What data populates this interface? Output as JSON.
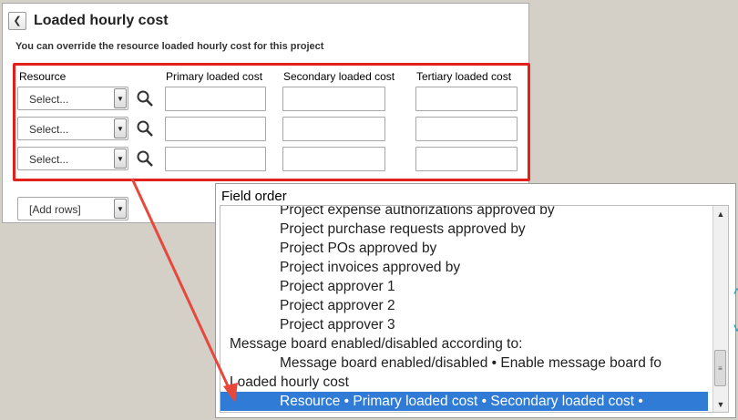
{
  "panel": {
    "collapse_icon": "double-chevron-up-icon",
    "title": "Loaded hourly cost",
    "subtitle": "You can override the resource loaded hourly cost for this project"
  },
  "columns": {
    "resource": "Resource",
    "primary": "Primary loaded cost",
    "secondary": "Secondary loaded cost",
    "tertiary": "Tertiary loaded cost"
  },
  "rows": [
    {
      "resource": "Select...",
      "primary": "",
      "secondary": "",
      "tertiary": ""
    },
    {
      "resource": "Select...",
      "primary": "",
      "secondary": "",
      "tertiary": ""
    },
    {
      "resource": "Select...",
      "primary": "",
      "secondary": "",
      "tertiary": ""
    }
  ],
  "add_rows": {
    "label": "[Add rows]"
  },
  "field_order": {
    "title": "Field order",
    "items": [
      {
        "text": "Project expense authorizations approved by",
        "level": 2
      },
      {
        "text": "Project purchase requests approved by",
        "level": 2
      },
      {
        "text": "Project POs approved by",
        "level": 2
      },
      {
        "text": "Project invoices approved by",
        "level": 2
      },
      {
        "text": "Project approver 1",
        "level": 2
      },
      {
        "text": "Project approver 2",
        "level": 2
      },
      {
        "text": "Project approver 3",
        "level": 2
      },
      {
        "text": "Message board enabled/disabled according to:",
        "level": 1
      },
      {
        "text": "Message board enabled/disabled • Enable message board fo",
        "level": 2
      },
      {
        "text": "Loaded hourly cost",
        "level": 1
      },
      {
        "text": "Resource • Primary loaded cost • Secondary loaded cost •",
        "level": 2,
        "selected": true
      }
    ]
  },
  "colors": {
    "highlight": "#e2211c",
    "arrow": "#e8483b",
    "selection": "#2f7bd6"
  }
}
